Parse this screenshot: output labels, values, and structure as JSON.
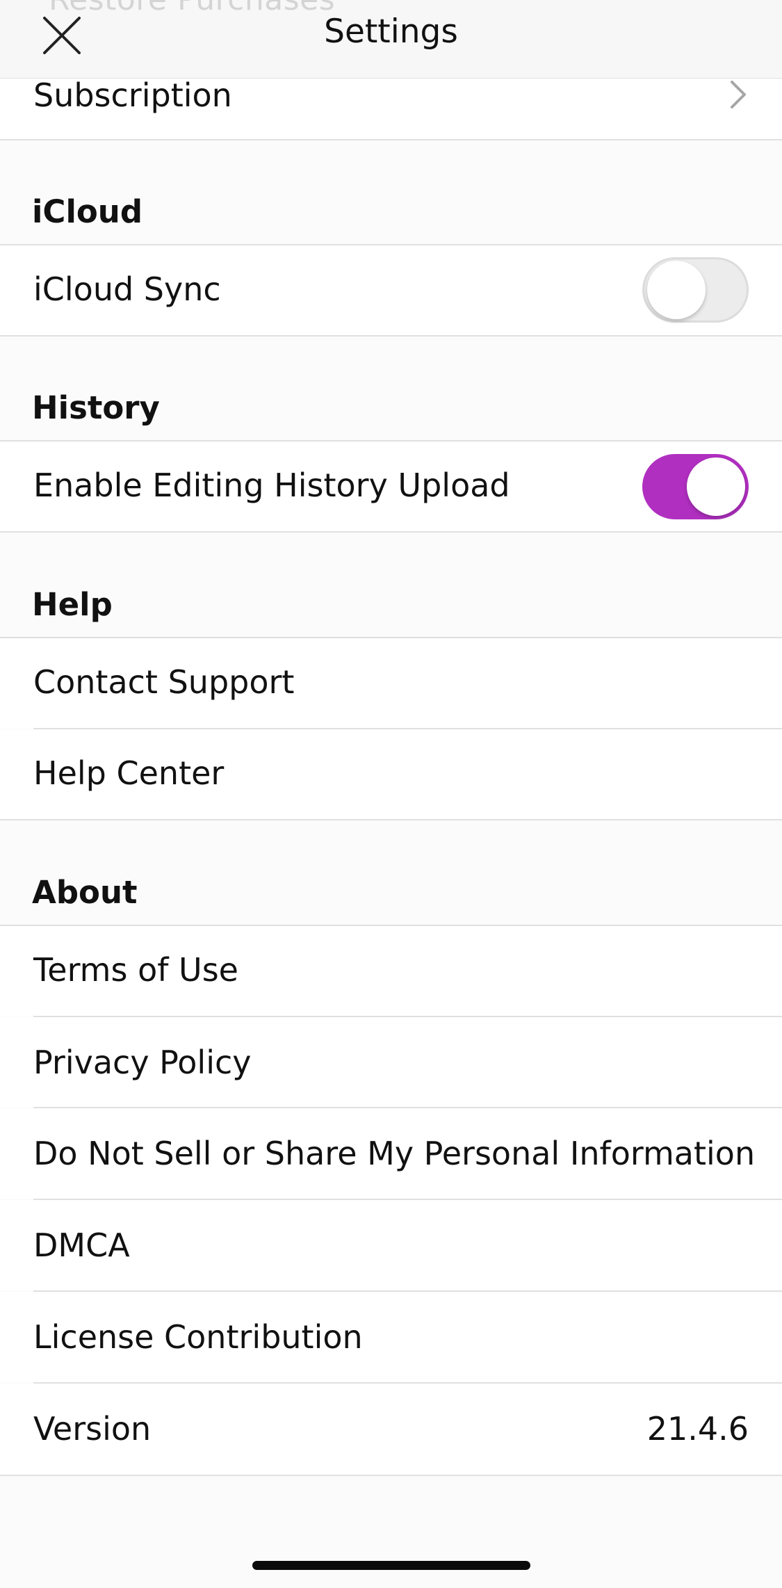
{
  "nav": {
    "title": "Settings",
    "behind_text": "Restore Purchases"
  },
  "subscription": {
    "label": "Subscription"
  },
  "icloud": {
    "header": "iCloud",
    "sync_label": "iCloud Sync",
    "sync_on": false
  },
  "history": {
    "header": "History",
    "upload_label": "Enable Editing History Upload",
    "upload_on": true
  },
  "help": {
    "header": "Help",
    "items": [
      {
        "label": "Contact Support"
      },
      {
        "label": "Help Center"
      }
    ]
  },
  "about": {
    "header": "About",
    "items": [
      {
        "label": "Terms of Use"
      },
      {
        "label": "Privacy Policy"
      },
      {
        "label": "Do Not Sell or Share My Personal Information"
      },
      {
        "label": "DMCA"
      },
      {
        "label": "License Contribution"
      }
    ],
    "version_label": "Version",
    "version_value": "21.4.6"
  },
  "colors": {
    "accent": "#b02fc0",
    "background": "#fbfbfb",
    "row_background": "#ffffff",
    "separator": "#e0e0e0"
  },
  "icons": {
    "close": "close-icon",
    "chevron": "chevron-right-icon"
  }
}
